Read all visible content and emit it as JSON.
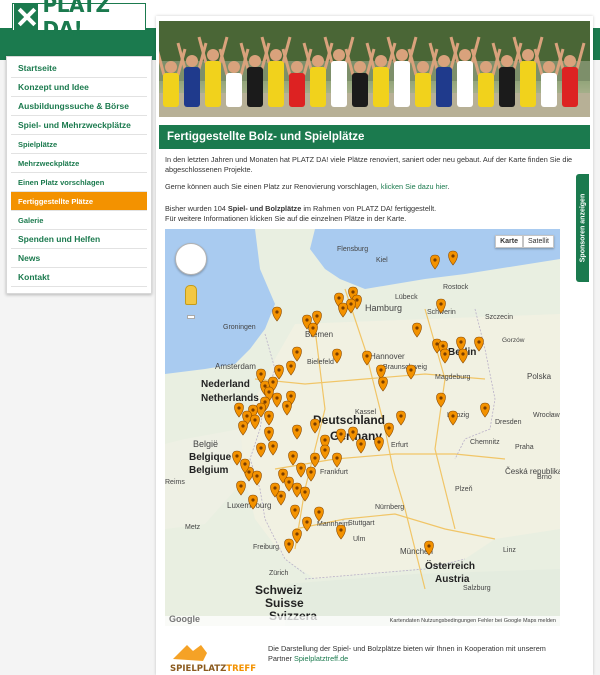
{
  "logo": {
    "text": "PLATZ DA!"
  },
  "nav": [
    {
      "label": "Startseite",
      "level": 1,
      "active": false
    },
    {
      "label": "Konzept und Idee",
      "level": 1,
      "active": false
    },
    {
      "label": "Ausbildungssuche & Börse",
      "level": 1,
      "active": false
    },
    {
      "label": "Spiel- und Mehrzweckplätze",
      "level": 1,
      "active": false
    },
    {
      "label": "Spielplätze",
      "level": 2,
      "active": false
    },
    {
      "label": "Mehrzweckplätze",
      "level": 2,
      "active": false
    },
    {
      "label": "Einen Platz vorschlagen",
      "level": 2,
      "active": false
    },
    {
      "label": "Fertiggestellte Plätze",
      "level": 2,
      "active": true
    },
    {
      "label": "Galerie",
      "level": 2,
      "active": false
    },
    {
      "label": "Spenden und Helfen",
      "level": 1,
      "active": false
    },
    {
      "label": "News",
      "level": 1,
      "active": false
    },
    {
      "label": "Kontakt",
      "level": 1,
      "active": false
    }
  ],
  "page": {
    "title": "Fertiggestellte Bolz- und Spielplätze",
    "intro": "In den letzten Jahren und Monaten hat PLATZ DA! viele Plätze renoviert, saniert oder neu gebaut. Auf der Karte finden Sie die abgeschlossenen Projekte.",
    "suggest_text": "Gerne können auch Sie einen Platz zur Renovierung vorschlagen,",
    "suggest_link": "klicken Sie dazu hier",
    "suggest_end": ".",
    "count_pre": "Bisher wurden 104",
    "count_bold": "Spiel- und Bolzplätze",
    "count_post": "im Rahmen von PLATZ DA! fertiggestellt.",
    "more_info": "Für weitere Informationen klicken Sie auf die einzelnen Plätze in der Karte."
  },
  "map": {
    "type_map": "Karte",
    "type_sat": "Satellit",
    "google": "Google",
    "attribution": "Kartendaten   Nutzungsbedingungen   Fehler bei Google Maps melden",
    "labels": [
      {
        "text": "Flensburg"
      },
      {
        "text": "Kiel"
      },
      {
        "text": "Rostock"
      },
      {
        "text": "Lübeck"
      },
      {
        "text": "Hamburg"
      },
      {
        "text": "Schwerin"
      },
      {
        "text": "Szczecin"
      },
      {
        "text": "Groningen"
      },
      {
        "text": "Bremen"
      },
      {
        "text": "Amsterdam"
      },
      {
        "text": "Nederland"
      },
      {
        "text": "Netherlands"
      },
      {
        "text": "Hannover"
      },
      {
        "text": "Berlin"
      },
      {
        "text": "Gorzów"
      },
      {
        "text": "Bielefeld"
      },
      {
        "text": "Braunschweig"
      },
      {
        "text": "Magdeburg"
      },
      {
        "text": "Deutschland"
      },
      {
        "text": "Germany"
      },
      {
        "text": "België"
      },
      {
        "text": "Belgique"
      },
      {
        "text": "Belgium"
      },
      {
        "text": "Leipzig"
      },
      {
        "text": "Dresden"
      },
      {
        "text": "Chemnitz"
      },
      {
        "text": "Praha"
      },
      {
        "text": "Česká republika"
      },
      {
        "text": "Luxembourg"
      },
      {
        "text": "Frankfurt"
      },
      {
        "text": "Nürnberg"
      },
      {
        "text": "Mannheim"
      },
      {
        "text": "Stuttgart"
      },
      {
        "text": "München"
      },
      {
        "text": "Österreich"
      },
      {
        "text": "Austria"
      },
      {
        "text": "Schweiz"
      },
      {
        "text": "Suisse"
      },
      {
        "text": "Svizzera"
      },
      {
        "text": "Freiburg"
      },
      {
        "text": "Polska"
      },
      {
        "text": "Wrocław"
      },
      {
        "text": "Kassel"
      },
      {
        "text": "Erfurt"
      },
      {
        "text": "Ulm"
      },
      {
        "text": "Salzburg"
      },
      {
        "text": "Brno"
      },
      {
        "text": "Zürich"
      },
      {
        "text": "Metz"
      },
      {
        "text": "Reims"
      },
      {
        "text": "Linz"
      },
      {
        "text": "Plzeň"
      }
    ]
  },
  "side_tab": {
    "label": "Sponsoren anzeigen"
  },
  "footer": {
    "logo_a": "SPIELPLATZ",
    "logo_b": "TREFF",
    "text": "Die Darstellung der Spiel- und Bolzplätze bieten wir Ihnen in Kooperation mit unserem Partner",
    "link": "Spielplatztreff.de"
  },
  "colors": {
    "brand": "#1b7a4e",
    "accent": "#f39200",
    "pin": "#f39200"
  }
}
